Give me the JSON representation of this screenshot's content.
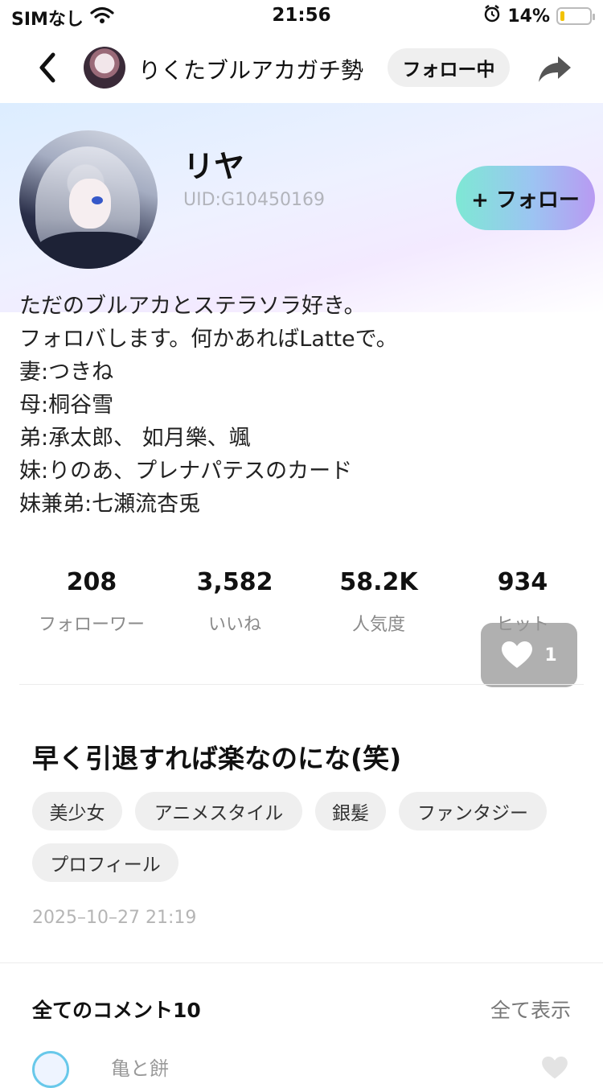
{
  "status_bar": {
    "carrier": "SIMなし",
    "time": "21:56",
    "battery": "14%",
    "battery_level": 0.14
  },
  "header": {
    "user_name": "りくたブルアカガチ勢",
    "follow_state": "フォロー中"
  },
  "profile": {
    "name": "リヤ",
    "uid": "UID:G10450169",
    "follow_button": "+ フォロー",
    "bio": [
      "ただのブルアカとステラソラ好き。",
      "フォロバします。何かあればLatteで。",
      "妻:つきね",
      "母:桐谷雪",
      "弟:承太郎、 如月樂、颯",
      "妹:りのあ、プレナパテスのカード",
      "妹兼弟:七瀬流杏兎"
    ],
    "stats": [
      {
        "value": "208",
        "label": "フォローワー"
      },
      {
        "value": "3,582",
        "label": "いいね"
      },
      {
        "value": "58.2K",
        "label": "人気度"
      },
      {
        "value": "934",
        "label": "ヒット"
      }
    ]
  },
  "like_float": {
    "count": "1"
  },
  "post": {
    "title": "早く引退すれば楽なのにな(笑)",
    "tags": [
      "美少女",
      "アニメスタイル",
      "銀髪",
      "ファンタジー",
      "プロフィール"
    ],
    "date": "2025–10–27 21:19"
  },
  "comments": {
    "title": "全てのコメント10",
    "see_all": "全て表示",
    "first_commenter": "亀と餅"
  },
  "colors": {
    "follow_gradient": [
      "#7ee8d4",
      "#b89af2"
    ],
    "chip_bg": "#efefef"
  }
}
